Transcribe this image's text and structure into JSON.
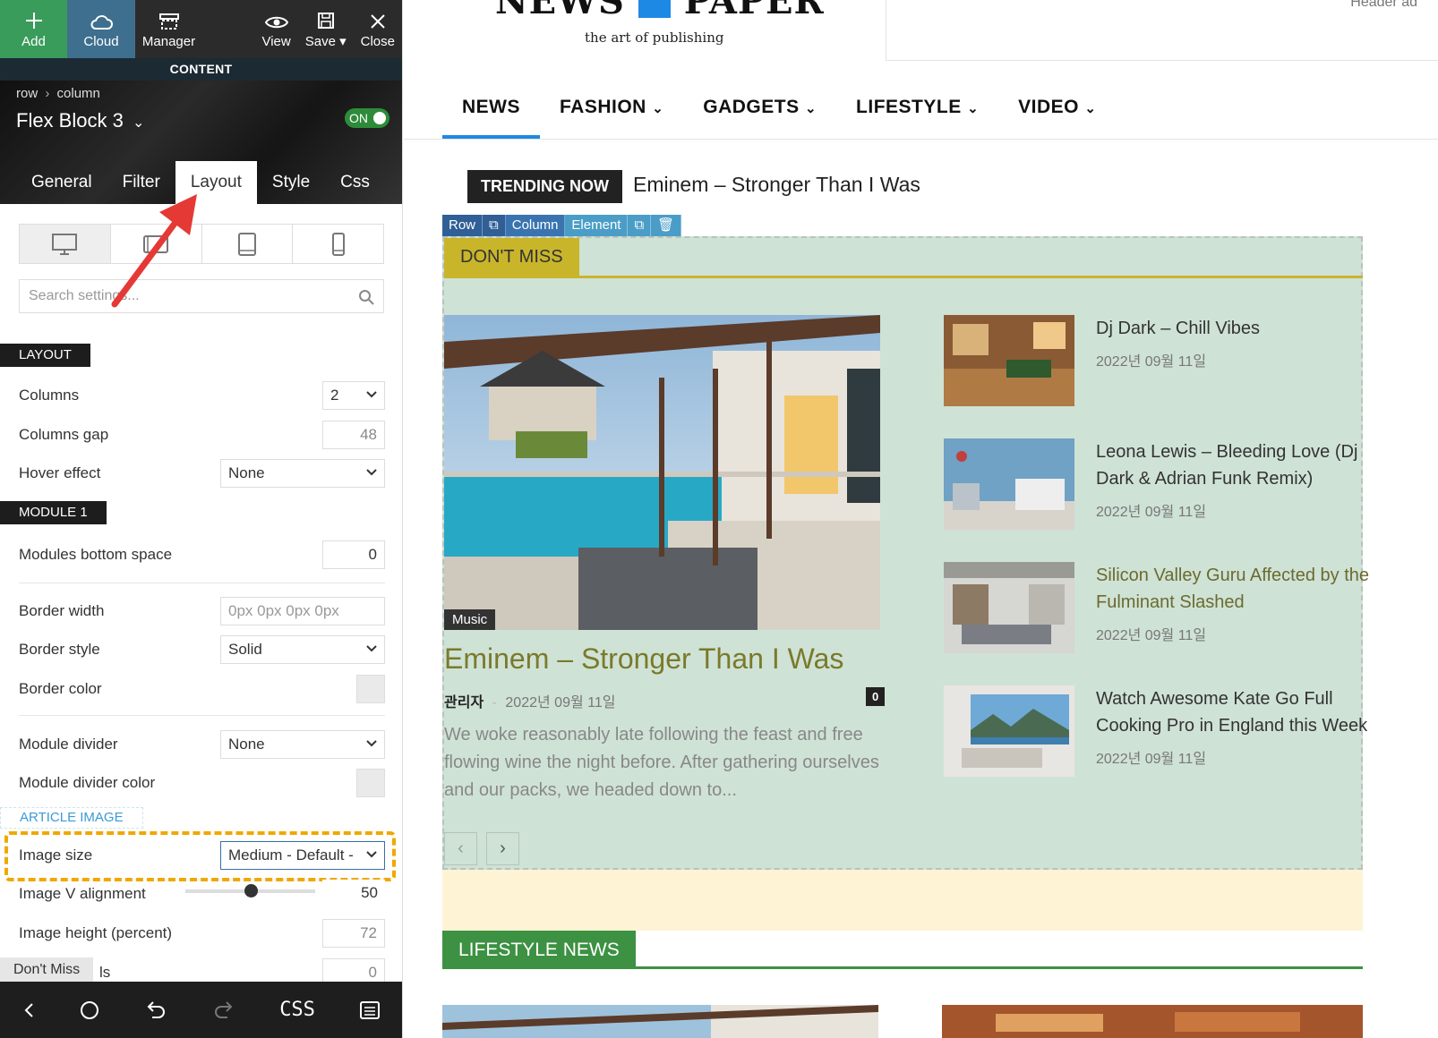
{
  "toolbar": {
    "add": "Add",
    "cloud": "Cloud",
    "manager": "Manager",
    "view": "View",
    "save": "Save",
    "close": "Close"
  },
  "panel": {
    "content_label": "CONTENT",
    "breadcrumb": [
      "row",
      "column"
    ],
    "block_title": "Flex Block 3",
    "toggle": "ON",
    "tabs": [
      "General",
      "Filter",
      "Layout",
      "Style",
      "Css"
    ],
    "active_tab": "Layout",
    "search_placeholder": "Search settings...",
    "sections": {
      "layout": "LAYOUT",
      "module1": "MODULE 1",
      "article_image": "ARTICLE IMAGE"
    },
    "fields": {
      "columns": {
        "label": "Columns",
        "value": "2"
      },
      "columns_gap": {
        "label": "Columns gap",
        "value": "48"
      },
      "hover_effect": {
        "label": "Hover effect",
        "value": "None"
      },
      "modules_bottom_space": {
        "label": "Modules bottom space",
        "value": "0"
      },
      "border_width": {
        "label": "Border width",
        "placeholder": "0px 0px 0px 0px"
      },
      "border_style": {
        "label": "Border style",
        "value": "Solid"
      },
      "border_color": {
        "label": "Border color"
      },
      "module_divider": {
        "label": "Module divider",
        "value": "None"
      },
      "module_divider_color": {
        "label": "Module divider color"
      },
      "image_size": {
        "label": "Image size",
        "value": "Medium - Default -"
      },
      "image_v_alignment": {
        "label": "Image V alignment",
        "value": "50",
        "slider_fraction": 0.5
      },
      "image_height": {
        "label": "Image height (percent)",
        "value": "72"
      },
      "last_row": {
        "label": "ls",
        "value": "0"
      }
    },
    "tooltip": "Don't Miss",
    "bottom_css": "CSS"
  },
  "site": {
    "logo": "NEWS PAPER",
    "tagline": "the art of publishing",
    "header_ad": "Header ad",
    "nav": [
      "NEWS",
      "FASHION",
      "GADGETS",
      "LIFESTYLE",
      "VIDEO"
    ],
    "trending_label": "TRENDING NOW",
    "trending_title": "Eminem – Stronger Than I Was",
    "builder_crumbs": {
      "row": "Row",
      "column": "Column",
      "element": "Element"
    },
    "dont_miss": "DON'T MISS",
    "main_post": {
      "category": "Music",
      "title": "Eminem – Stronger Than I Was",
      "author": "관리자",
      "separator": "-",
      "date": "2022년 09월 11일",
      "comments": "0",
      "excerpt": "We woke reasonably late following the feast and free flowing wine the night before. After gathering ourselves and our packs, we headed down to..."
    },
    "side_posts": [
      {
        "title": "Dj Dark – Chill Vibes",
        "date": "2022년 09월 11일"
      },
      {
        "title": "Leona Lewis – Bleeding Love (Dj Dark & Adrian Funk Remix)",
        "date": "2022년 09월 11일"
      },
      {
        "title": "Silicon Valley Guru Affected by the Fulminant Slashed",
        "date": "2022년 09월 11일"
      },
      {
        "title": "Watch Awesome Kate Go Full Cooking Pro in England this Week",
        "date": "2022년 09월 11일"
      }
    ],
    "pagination": {
      "prev": "‹",
      "next": "›"
    },
    "lifestyle_news": "LIFESTYLE NEWS"
  },
  "colors": {
    "add_green": "#3a9c5b",
    "cloud_blue": "#3f6f8e",
    "block_bg": "#cfe2d6",
    "dont_miss_yellow": "#c8b52a",
    "lifestyle_green": "#3c9142",
    "nav_active": "#1e88e5",
    "highlight_dash": "#f0a800",
    "annotation_arrow": "#e53935"
  }
}
